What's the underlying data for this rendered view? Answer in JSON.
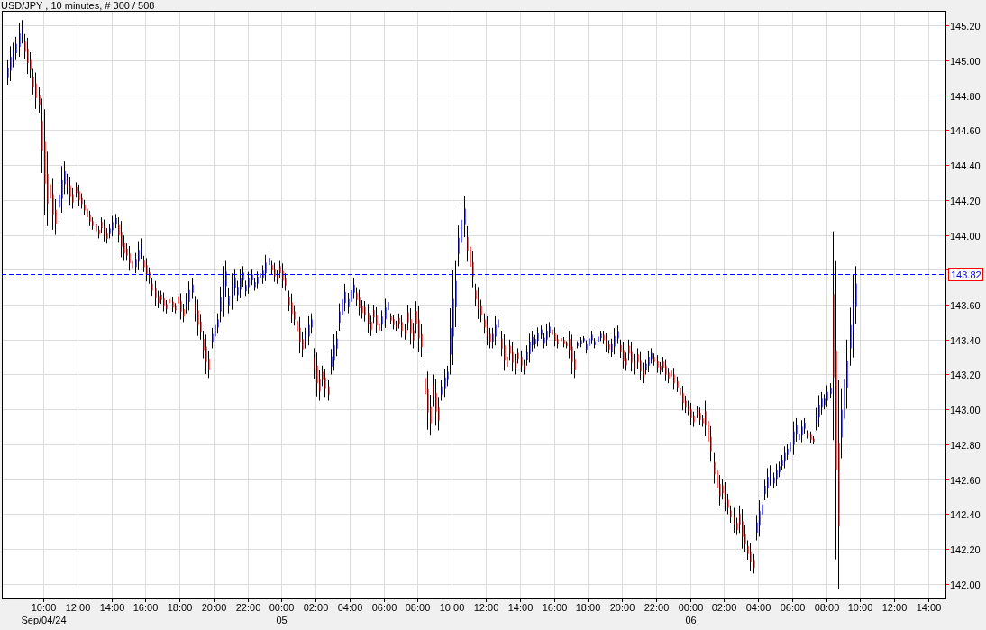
{
  "title": "USD/JPY , 10 minutes, # 300 / 508",
  "price_axis": {
    "labels": [
      "145.20",
      "145.00",
      "144.80",
      "144.60",
      "144.40",
      "144.20",
      "144.00",
      "143.60",
      "143.40",
      "143.20",
      "143.00",
      "142.80",
      "142.60",
      "142.40",
      "142.20",
      "142.00"
    ]
  },
  "last_price": "143.82",
  "time_axis": {
    "labels": [
      {
        "time": "10:00",
        "date": "Sep/04/24"
      },
      {
        "time": "12:00"
      },
      {
        "time": "14:00"
      },
      {
        "time": "16:00"
      },
      {
        "time": "18:00"
      },
      {
        "time": "20:00"
      },
      {
        "time": "22:00"
      },
      {
        "time": "00:00",
        "date": "05"
      },
      {
        "time": "02:00"
      },
      {
        "time": "04:00"
      },
      {
        "time": "06:00"
      },
      {
        "time": "08:00"
      },
      {
        "time": "10:00"
      },
      {
        "time": "12:00"
      },
      {
        "time": "14:00"
      },
      {
        "time": "16:00"
      },
      {
        "time": "18:00"
      },
      {
        "time": "20:00"
      },
      {
        "time": "22:00"
      },
      {
        "time": "00:00",
        "date": "06"
      },
      {
        "time": "02:00"
      },
      {
        "time": "04:00"
      },
      {
        "time": "06:00"
      },
      {
        "time": "08:00"
      },
      {
        "time": "10:00"
      },
      {
        "time": "12:00"
      },
      {
        "time": "14:00"
      }
    ]
  }
}
